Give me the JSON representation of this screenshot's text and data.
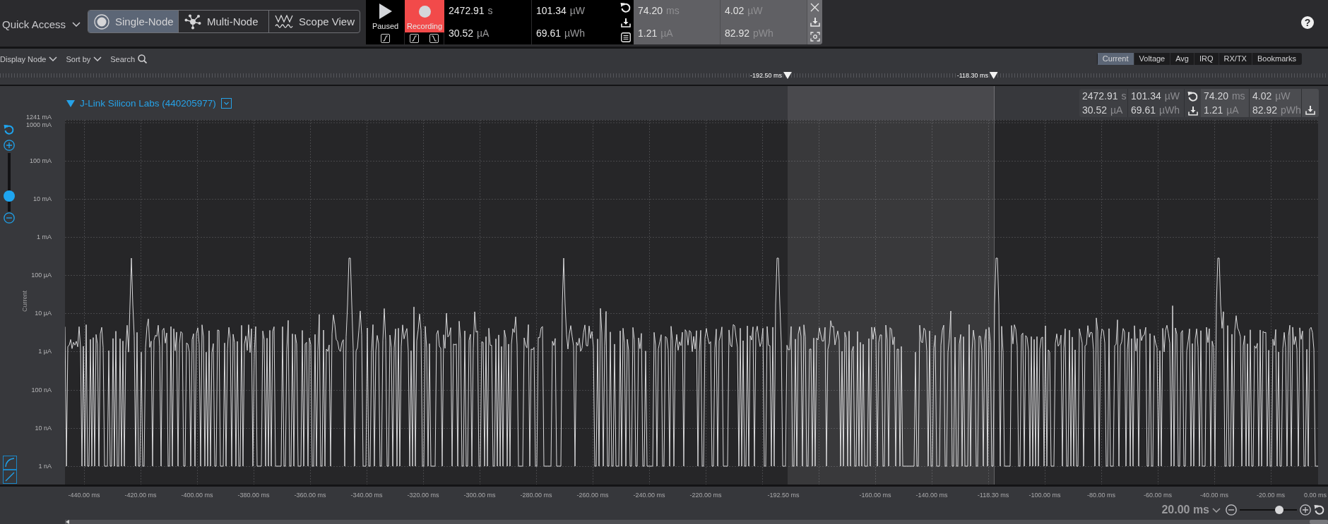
{
  "toolbar": {
    "quick_access": {
      "label": "Quick Access"
    },
    "view_modes": [
      {
        "kind": "single",
        "label": "Single-Node",
        "selected": true
      },
      {
        "kind": "multi",
        "label": "Multi-Node",
        "selected": false
      },
      {
        "kind": "scope",
        "label": "Scope View",
        "selected": false
      }
    ],
    "capture": [
      {
        "kind": "play",
        "label": "Paused",
        "active": false
      },
      {
        "kind": "record",
        "label": "Recording",
        "active": true
      }
    ],
    "live_readings": [
      {
        "value": "2472.91",
        "unit": "s"
      },
      {
        "value": "30.52",
        "unit": "µA"
      },
      {
        "value": "101.34",
        "unit": "µW"
      },
      {
        "value": "69.61",
        "unit": "µWh"
      }
    ],
    "selection_readings": [
      {
        "value": "74.20",
        "unit": "ms"
      },
      {
        "value": "1.21",
        "unit": "µA"
      },
      {
        "value": "4.02",
        "unit": "µW"
      },
      {
        "value": "82.92",
        "unit": "pWh"
      }
    ],
    "help": {
      "label": "?"
    }
  },
  "filter_bar": {
    "controls": [
      {
        "kind": "dropdown",
        "label": "Display Node"
      },
      {
        "kind": "dropdown",
        "label": "Sort by"
      },
      {
        "kind": "search",
        "label": "Search"
      }
    ],
    "tabs": [
      {
        "label": "Current",
        "selected": true
      },
      {
        "label": "Voltage",
        "selected": false
      },
      {
        "label": "Avg",
        "selected": false
      },
      {
        "label": "IRQ",
        "selected": false
      },
      {
        "label": "RX/TX",
        "selected": false
      },
      {
        "label": "Bookmarks",
        "selected": false
      }
    ]
  },
  "ruler": {
    "markers": [
      {
        "label": "-192.50 ms"
      },
      {
        "label": "-118.30 ms"
      }
    ]
  },
  "chart": {
    "device": {
      "label": "J-Link Silicon Labs (440205977)",
      "expanded": true
    },
    "live_readings": [
      {
        "value": "2472.91",
        "unit": "s"
      },
      {
        "value": "30.52",
        "unit": "µA"
      },
      {
        "value": "101.34",
        "unit": "µW"
      },
      {
        "value": "69.61",
        "unit": "µWh"
      }
    ],
    "selection_readings": [
      {
        "value": "74.20",
        "unit": "ms"
      },
      {
        "value": "1.21",
        "unit": "µA"
      },
      {
        "value": "4.02",
        "unit": "µW"
      },
      {
        "value": "82.92",
        "unit": "pWh"
      }
    ],
    "zoom": {
      "level": 0.21
    },
    "y_axis": {
      "title": "Current",
      "ticks": [
        "1241 mA",
        "1000 mA",
        "100 mA",
        "10 mA",
        "1 mA",
        "100 µA",
        "10 µA",
        "1 µA",
        "100 nA",
        "10 nA",
        "1 nA"
      ]
    },
    "x_axis": {
      "ticks": [
        "-440.00 ms",
        "-420.00 ms",
        "-400.00 ms",
        "-380.00 ms",
        "-360.00 ms",
        "-340.00 ms",
        "-320.00 ms",
        "-300.00 ms",
        "-280.00 ms",
        "-260.00 ms",
        "-240.00 ms",
        "-220.00 ms",
        "-192.50 ms",
        "-160.00 ms",
        "-140.00 ms",
        "-118.30 ms",
        "-100.00 ms",
        "-80.00 ms",
        "-60.00 ms",
        "-40.00 ms",
        "-20.00 ms",
        "0.00 ms"
      ]
    }
  },
  "time_zoom": {
    "label": "20.00 ms",
    "level": 0.72
  }
}
